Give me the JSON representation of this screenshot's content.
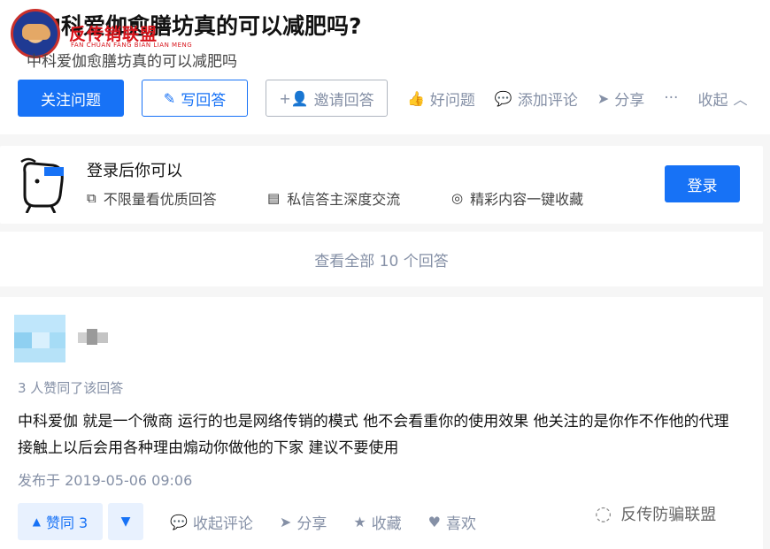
{
  "logo": {
    "text_cn": "反传销联盟",
    "text_en": "FAN CHUAN FANG BIAN LIAN MENG"
  },
  "question": {
    "title": "中科爱伽愈膳坊真的可以减肥吗?",
    "subtitle": "中科爱伽愈膳坊真的可以减肥吗"
  },
  "actions": {
    "follow": "关注问题",
    "write": "写回答",
    "invite": "邀请回答",
    "good": "好问题",
    "comment": "添加评论",
    "share": "分享",
    "more": "···",
    "collapse": "收起"
  },
  "login": {
    "title": "登录后你可以",
    "features": [
      "不限量看优质回答",
      "私信答主深度交流",
      "精彩内容一键收藏"
    ],
    "button": "登录"
  },
  "view_all": "查看全部 10 个回答",
  "answer": {
    "votes_text": "3 人赞同了该回答",
    "content": "中科爱伽 就是一个微商 运行的也是网络传销的模式 他不会看重你的使用效果 他关注的是你作不作他的代理 接触上以后会用各种理由煽动你做他的下家 建议不要使用",
    "published": "发布于 2019-05-06 09:06",
    "vote_up": "赞同 3",
    "collapse_comments": "收起评论",
    "share": "分享",
    "favorite": "收藏",
    "like": "喜欢"
  },
  "watermark": "反传防骗联盟",
  "colors": {
    "primary": "#1772f6",
    "muted": "#8590a6",
    "logo_red": "#d8141b"
  }
}
